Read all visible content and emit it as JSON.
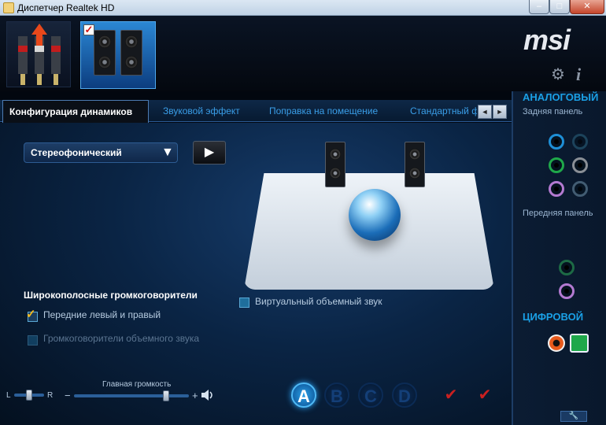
{
  "window": {
    "title": "Диспетчер Realtek HD",
    "min": "–",
    "max": "□",
    "close": "✕"
  },
  "brand": {
    "logo": "msi"
  },
  "tabs": {
    "active": "Конфигурация динамиков",
    "items": [
      "Звуковой эффект",
      "Поправка на помещение",
      "Стандартный формат"
    ],
    "prev": "◄",
    "next": "►"
  },
  "config": {
    "selected": "Стереофонический",
    "arrow": "▼",
    "play": "▶"
  },
  "virtual_surround": {
    "label": "Виртуальный объемный звук",
    "checked": false
  },
  "fullrange": {
    "title": "Широкополосные громкоговорители",
    "front": {
      "label": "Передние левый и правый",
      "checked": true
    },
    "surround": {
      "label": "Громкоговорители объемного звука",
      "checked": false
    }
  },
  "balance": {
    "left": "L",
    "right": "R",
    "value": 0.5
  },
  "volume": {
    "label": "Главная громкость",
    "minus": "−",
    "plus": "+",
    "value": 0.8
  },
  "profiles": [
    "A",
    "B",
    "C",
    "D"
  ],
  "right_panel": {
    "analog": "АНАЛОГОВЫЙ",
    "rear": "Задняя панель",
    "front": "Передняя панель",
    "digital": "ЦИФРОВОЙ"
  },
  "colors": {
    "accent": "#1aa0e6",
    "jack_blue": "#1e8fd6",
    "jack_green": "#1fa84a",
    "jack_pink": "#b37ad1",
    "jack_gray": "#8a8f96"
  }
}
